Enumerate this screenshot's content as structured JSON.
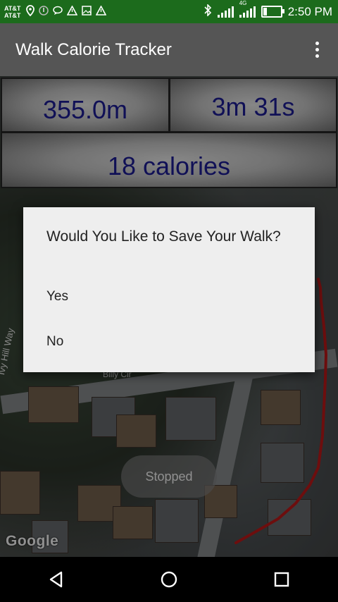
{
  "status_bar": {
    "carrier_line1": "AT&T",
    "carrier_line2": "AT&T",
    "network": "4G",
    "time": "2:50 PM",
    "icons": [
      "location-icon",
      "alert-icon",
      "chat-icon",
      "warning-icon",
      "image-icon",
      "warning-icon",
      "bluetooth-icon",
      "signal-icon",
      "battery-icon"
    ]
  },
  "app_bar": {
    "title": "Walk Calorie Tracker",
    "menu_icon": "overflow-menu-icon"
  },
  "stats": {
    "distance": "355.0m",
    "duration": "3m 31s",
    "calories": "18 calories"
  },
  "dialog": {
    "title": "Would You Like to Save Your Walk?",
    "yes_label": "Yes",
    "no_label": "No"
  },
  "map": {
    "status_label": "Stopped",
    "attribution": "Google",
    "street_label_1": "Ivy Hill Way",
    "street_label_2": "Billy Cir",
    "route_color": "#b01818"
  },
  "nav_bar": {
    "icons": [
      "back-icon",
      "home-icon",
      "recents-icon"
    ]
  },
  "colors": {
    "status_bar": "#1c6b1c",
    "app_bar": "#555555",
    "stat_text": "#1a1a8c",
    "dialog_bg": "#eeeeee"
  }
}
